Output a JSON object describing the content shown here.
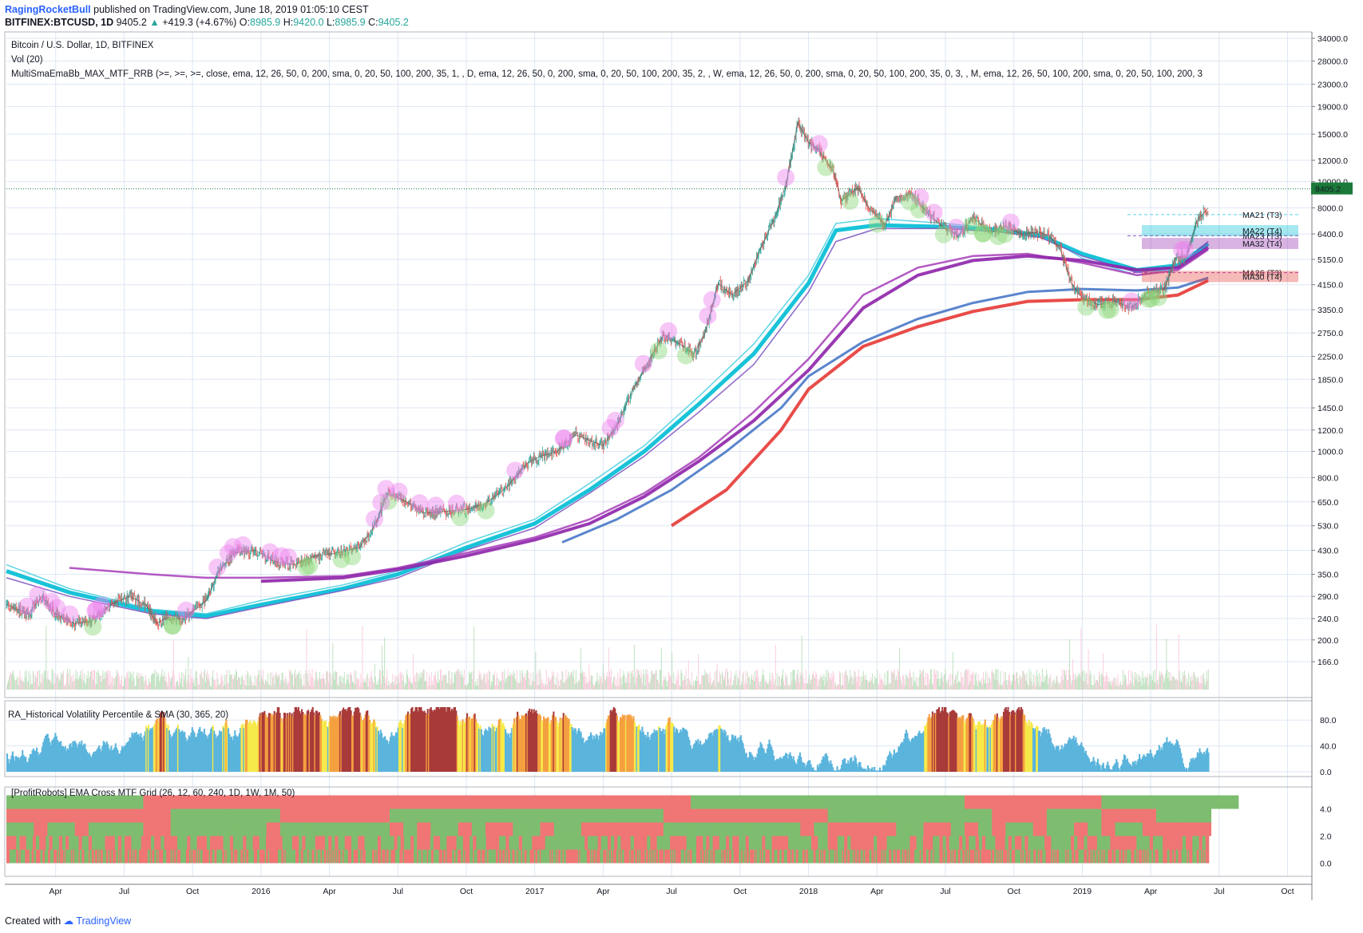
{
  "header": {
    "author": "RagingRocketBull",
    "published": "published on TradingView.com, June 18, 2019 01:05:10 CEST",
    "symbol": "BITFINEX:BTCUSD, 1D",
    "last": "9405.2",
    "change": "+419.3 (+4.67%)",
    "o_label": "O:",
    "o": "8985.9",
    "h_label": "H:",
    "h": "9420.0",
    "l_label": "L:",
    "l": "8985.9",
    "c_label": "C:",
    "c": "9405.2"
  },
  "legend": {
    "title": "Bitcoin / U.S. Dollar, 1D, BITFINEX",
    "vol": "Vol (20)",
    "indicator": "MultiSmaEmaBb_MAX_MTF_RRB (>=, >=, >=, close, ema, 12, 26, 50, 0, 200, sma, 0, 20, 50, 100, 200, 35, 1, , D, ema, 12, 26, 50, 0, 200, sma, 0, 20, 50, 100, 200, 35, 2, , W, ema, 12, 26, 50, 0, 200, sma, 0, 20, 50, 100, 200, 35, 0, 3, , M, ema, 12, 26, 50, 100, 200, sma, 0, 20, 50, 100, 200, 3",
    "pane2": "RA_Historical Volatility Percentile & SMA (30, 365, 20)",
    "pane3": "[ProfitRobots] EMA Cross MTF Grid (26, 12, 60, 240, 1D, 1W, 1M, 50)"
  },
  "price_badge": "9405.2",
  "ma_labels": [
    {
      "text": "MA21 (T3)",
      "price": 7550,
      "color": "#5ad0e6",
      "box": false
    },
    {
      "text": "MA22 (T4)",
      "price": 6580,
      "color": "#00bcd4",
      "box": true
    },
    {
      "text": "MA23 (T3)",
      "price": 6300,
      "color": "#7e57c2",
      "box": false
    },
    {
      "text": "MA32 (T4)",
      "price": 5900,
      "color": "#8e24aa",
      "box": true
    },
    {
      "text": "MA26 (T3)",
      "price": 4600,
      "color": "#ab47bc",
      "box": false
    },
    {
      "text": "MA30 (T4)",
      "price": 4450,
      "color": "#e53935",
      "box": true
    }
  ],
  "footer": {
    "created_with": "Created with",
    "brand": "TradingView"
  },
  "chart_data": {
    "type": "line",
    "title": "Bitcoin / U.S. Dollar, 1D, BITFINEX",
    "scale": "log",
    "y_ticks": [
      "34000.0",
      "28000.0",
      "23000.0",
      "19000.0",
      "15000.0",
      "12000.0",
      "10000.0",
      "8000.0",
      "6400.0",
      "5150.0",
      "4150.0",
      "3350.0",
      "2750.0",
      "2250.0",
      "1850.0",
      "1450.0",
      "1200.0",
      "1000.0",
      "800.0",
      "650.0",
      "530.0",
      "430.0",
      "350.0",
      "290.0",
      "240.0",
      "200.0",
      "166.0"
    ],
    "ylim": [
      150,
      34000
    ],
    "x_ticks": [
      "Apr",
      "Jul",
      "Oct",
      "2016",
      "Apr",
      "Jul",
      "Oct",
      "2017",
      "Apr",
      "Jul",
      "Oct",
      "2018",
      "Apr",
      "Jul",
      "Oct",
      "2019",
      "Apr",
      "Jul",
      "Oct"
    ],
    "x_tick_years": [
      2015.25,
      2015.5,
      2015.75,
      2016.0,
      2016.25,
      2016.5,
      2016.75,
      2017.0,
      2017.25,
      2017.5,
      2017.75,
      2018.0,
      2018.25,
      2018.5,
      2018.75,
      2019.0,
      2019.25,
      2019.5,
      2019.75
    ],
    "xlim": [
      2015.07,
      2019.83
    ],
    "price_series": {
      "name": "BTCUSD",
      "x": [
        2015.07,
        2015.15,
        2015.2,
        2015.25,
        2015.32,
        2015.38,
        2015.45,
        2015.52,
        2015.58,
        2015.62,
        2015.65,
        2015.72,
        2015.8,
        2015.84,
        2015.9,
        2015.98,
        2016.05,
        2016.12,
        2016.2,
        2016.28,
        2016.36,
        2016.42,
        2016.46,
        2016.52,
        2016.6,
        2016.68,
        2016.75,
        2016.82,
        2016.9,
        2016.97,
        2017.02,
        2017.08,
        2017.15,
        2017.2,
        2017.25,
        2017.3,
        2017.36,
        2017.42,
        2017.47,
        2017.53,
        2017.58,
        2017.62,
        2017.67,
        2017.72,
        2017.78,
        2017.82,
        2017.88,
        2017.92,
        2017.96,
        2018.0,
        2018.04,
        2018.09,
        2018.12,
        2018.18,
        2018.22,
        2018.28,
        2018.32,
        2018.38,
        2018.44,
        2018.5,
        2018.55,
        2018.6,
        2018.66,
        2018.72,
        2018.78,
        2018.84,
        2018.88,
        2018.92,
        2018.96,
        2019.0,
        2019.06,
        2019.12,
        2019.18,
        2019.24,
        2019.3,
        2019.34,
        2019.38,
        2019.42,
        2019.46
      ],
      "y": [
        270,
        250,
        290,
        250,
        230,
        235,
        270,
        290,
        270,
        230,
        240,
        240,
        280,
        350,
        420,
        430,
        390,
        380,
        410,
        420,
        440,
        540,
        700,
        660,
        590,
        600,
        610,
        640,
        740,
        900,
        960,
        1000,
        1150,
        1100,
        1050,
        1250,
        1700,
        2200,
        2700,
        2500,
        2300,
        2700,
        4200,
        3800,
        4300,
        5500,
        7500,
        10000,
        16500,
        14000,
        13000,
        11000,
        8500,
        9500,
        8000,
        6900,
        8800,
        9000,
        7500,
        6700,
        6300,
        7400,
        6500,
        6800,
        6400,
        6500,
        6300,
        5600,
        4200,
        3700,
        3500,
        3600,
        3400,
        3900,
        4000,
        5200,
        5300,
        7200,
        8000
      ]
    },
    "ma_series": [
      {
        "name": "MA21 (T3)",
        "color": "#4dd0e1",
        "x": [
          2015.07,
          2015.3,
          2015.6,
          2015.8,
          2016.0,
          2016.3,
          2016.5,
          2016.75,
          2017.0,
          2017.2,
          2017.4,
          2017.6,
          2017.8,
          2018.0,
          2018.1,
          2018.25,
          2018.5,
          2018.7,
          2018.85,
          2019.0,
          2019.2,
          2019.35,
          2019.46
        ],
        "y": [
          380,
          310,
          260,
          250,
          280,
          320,
          360,
          460,
          560,
          760,
          1050,
          1600,
          2500,
          4500,
          7000,
          7300,
          7000,
          6700,
          6400,
          5200,
          4500,
          4800,
          5800
        ]
      },
      {
        "name": "MA22 (T4)",
        "color": "#00bcd4",
        "x": [
          2015.07,
          2015.3,
          2015.6,
          2015.8,
          2016.0,
          2016.3,
          2016.5,
          2016.75,
          2017.0,
          2017.2,
          2017.4,
          2017.6,
          2017.8,
          2018.0,
          2018.1,
          2018.25,
          2018.5,
          2018.7,
          2018.85,
          2019.0,
          2019.2,
          2019.35,
          2019.46
        ],
        "y": [
          360,
          300,
          255,
          245,
          270,
          310,
          350,
          440,
          540,
          720,
          1000,
          1500,
          2300,
          4200,
          6600,
          6900,
          6800,
          6600,
          6300,
          5400,
          4700,
          4900,
          5900
        ]
      },
      {
        "name": "MA23 (T3)",
        "color": "#7e57c2",
        "x": [
          2015.07,
          2015.3,
          2015.6,
          2015.8,
          2016.0,
          2016.3,
          2016.5,
          2016.75,
          2017.0,
          2017.2,
          2017.4,
          2017.6,
          2017.8,
          2018.0,
          2018.1,
          2018.25,
          2018.5,
          2018.7,
          2018.85,
          2019.0,
          2019.2,
          2019.35,
          2019.46
        ],
        "y": [
          340,
          290,
          250,
          240,
          265,
          305,
          340,
          430,
          520,
          700,
          960,
          1400,
          2100,
          3900,
          6000,
          6700,
          6700,
          6500,
          6200,
          5300,
          4600,
          4800,
          6000
        ]
      },
      {
        "name": "MA26 (T3)",
        "color": "#ab47bc",
        "x": [
          2015.3,
          2015.6,
          2015.8,
          2016.0,
          2016.3,
          2016.5,
          2016.75,
          2017.0,
          2017.2,
          2017.4,
          2017.6,
          2017.8,
          2018.0,
          2018.2,
          2018.4,
          2018.6,
          2018.8,
          2019.0,
          2019.2,
          2019.35,
          2019.46
        ],
        "y": [
          370,
          350,
          340,
          340,
          345,
          370,
          420,
          480,
          560,
          700,
          950,
          1400,
          2200,
          3800,
          4800,
          5300,
          5400,
          5000,
          4500,
          4700,
          5600
        ]
      },
      {
        "name": "MA32 (T4)",
        "color": "#8e24aa",
        "x": [
          2016.0,
          2016.3,
          2016.5,
          2016.75,
          2017.0,
          2017.2,
          2017.4,
          2017.6,
          2017.8,
          2018.0,
          2018.2,
          2018.4,
          2018.6,
          2018.8,
          2019.0,
          2019.2,
          2019.35,
          2019.46
        ],
        "y": [
          330,
          340,
          365,
          410,
          470,
          540,
          680,
          920,
          1300,
          2000,
          3400,
          4500,
          5100,
          5300,
          5100,
          4700,
          4800,
          5700
        ]
      },
      {
        "name": "MA27 (T4)",
        "color": "#4878c8",
        "x": [
          2017.1,
          2017.3,
          2017.5,
          2017.7,
          2017.9,
          2018.0,
          2018.2,
          2018.4,
          2018.6,
          2018.8,
          2019.0,
          2019.2,
          2019.35,
          2019.46
        ],
        "y": [
          460,
          560,
          720,
          1000,
          1450,
          1900,
          2550,
          3100,
          3550,
          3900,
          4000,
          3950,
          4050,
          4400
        ]
      },
      {
        "name": "MA30 (T4)",
        "color": "#e53935",
        "x": [
          2017.5,
          2017.7,
          2017.9,
          2018.0,
          2018.2,
          2018.4,
          2018.6,
          2018.8,
          2019.0,
          2019.2,
          2019.35,
          2019.46
        ],
        "y": [
          530,
          720,
          1200,
          1700,
          2450,
          2900,
          3300,
          3600,
          3650,
          3650,
          3800,
          4300
        ]
      }
    ],
    "volatility_pane": {
      "name": "RA_Historical Volatility Percentile & SMA (30, 365, 20)",
      "y_ticks": [
        "80.0",
        "40.0",
        "0.0"
      ],
      "ylim": [
        0,
        100
      ]
    },
    "grid_pane": {
      "name": "[ProfitRobots] EMA Cross MTF Grid (26, 12, 60, 240, 1D, 1W, 1M, 50)",
      "y_ticks": [
        "4.0",
        "2.0",
        "0.0"
      ],
      "ylim": [
        -0.5,
        5.5
      ]
    }
  }
}
